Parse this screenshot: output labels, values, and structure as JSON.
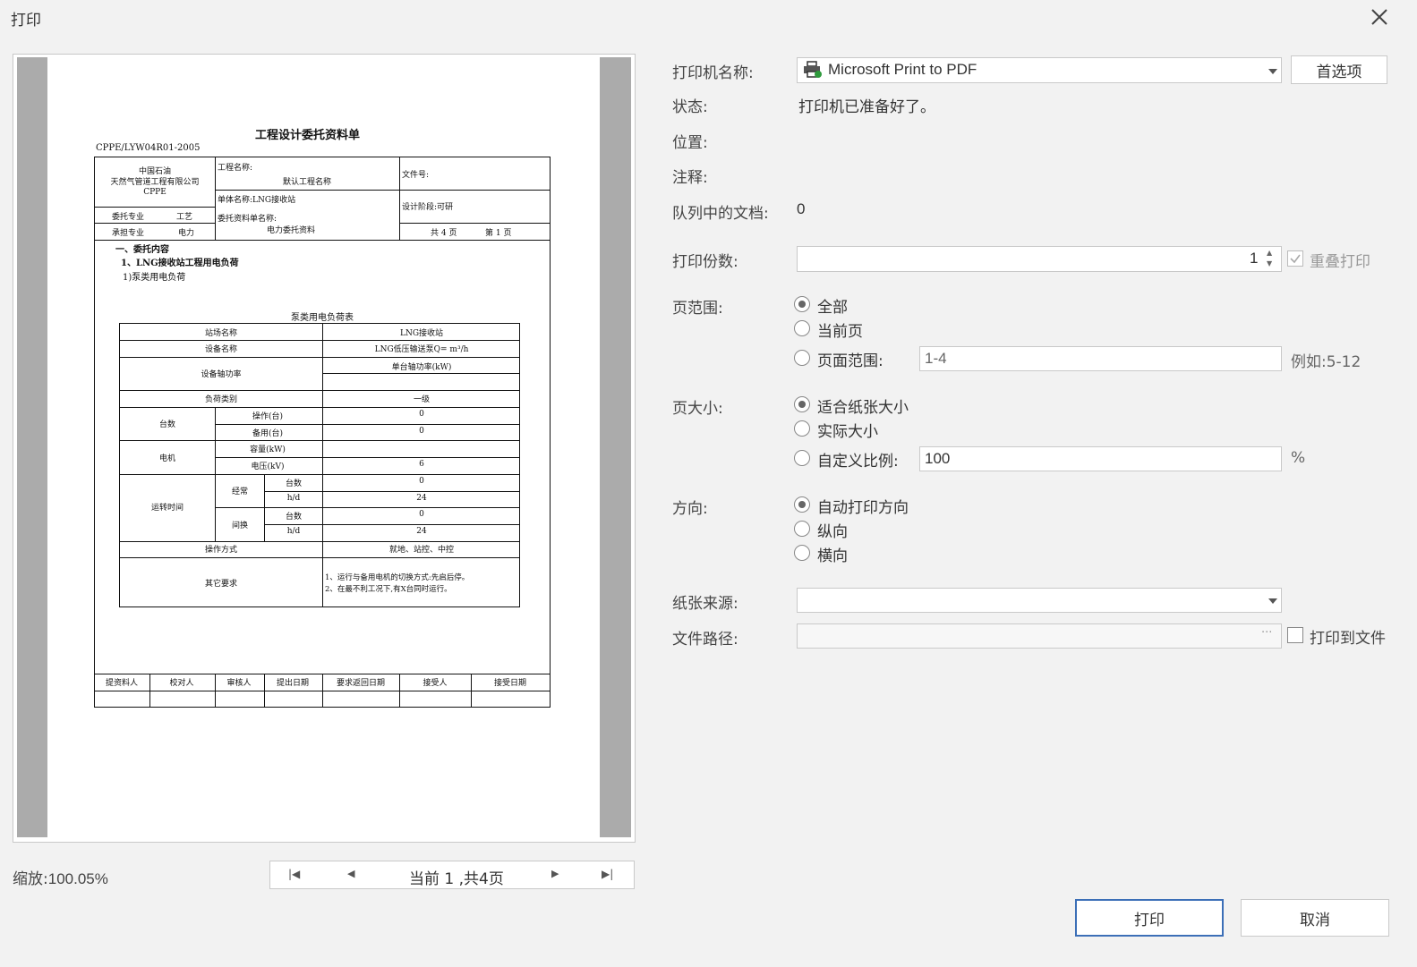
{
  "dialog": {
    "title": "打印"
  },
  "preview": {
    "zoom_label": "缩放:",
    "zoom_value": "100.05%",
    "nav": {
      "current_prefix": "当前",
      "current": "1",
      "sep": ",共",
      "total": "4",
      "suffix": "页"
    }
  },
  "document": {
    "title": "工程设计委托资料单",
    "code": "CPPE/LYW04R01-2005",
    "org1": "中国石油",
    "org2": "天然气管道工程有限公司",
    "org3": "CPPE",
    "project_name_label": "工程名称:",
    "project_name": "默认工程名称",
    "file_no_label": "文件号:",
    "unit_label": "单体名称:LNG接收站",
    "stage_label": "设计阶段:可研",
    "delegate_major_label": "委托专业",
    "delegate_major": "工艺",
    "receive_major_label": "承担专业",
    "receive_major": "电力",
    "form_name_label": "委托资料单名称:",
    "form_name": "电力委托资料",
    "pages_total": "共 4 页",
    "pages_current": "第 1 页",
    "sec1": "一、委托内容",
    "sec2": "1、LNG接收站工程用电负荷",
    "sec3": "1)泵类用电负荷",
    "table_title": "泵类用电负荷表",
    "rows": {
      "station_label": "站场名称",
      "station": "LNG接收站",
      "equip_label": "设备名称",
      "equip": "LNG低压输送泵Q= m³/h",
      "shaft_label": "设备轴功率",
      "shaft": "单台轴功率(kW)",
      "load_label": "负荷类别",
      "load": "一级",
      "count_label": "台数",
      "op_label": "操作(台)",
      "op": "0",
      "spare_label": "备用(台)",
      "spare": "0",
      "motor_label": "电机",
      "cap_label": "容量(kW)",
      "cap": "",
      "volt_label": "电压(kV)",
      "volt": "6",
      "runtime_label": "运转时间",
      "cont_label": "经常",
      "inter_label": "间换",
      "c_count_label": "台数",
      "c_count": "0",
      "c_hd_label": "h/d",
      "c_hd": "24",
      "i_count_label": "台数",
      "i_count": "0",
      "i_hd_label": "h/d",
      "i_hd": "24",
      "opmode_label": "操作方式",
      "opmode": "就地、站控、中控",
      "other_label": "其它要求",
      "other1": "1、运行与备用电机的切换方式:先启后停。",
      "other2": "2、在最不利工况下,有X台同时运行。"
    },
    "footer": [
      "提资料人",
      "校对人",
      "审核人",
      "提出日期",
      "要求返回日期",
      "接受人",
      "接受日期"
    ]
  },
  "printer": {
    "name_label": "打印机名称:",
    "name": "Microsoft Print to PDF",
    "prefs_button": "首选项",
    "status_label": "状态:",
    "status": "打印机已准备好了。",
    "location_label": "位置:",
    "comment_label": "注释:",
    "queue_label": "队列中的文档:",
    "queue": "0"
  },
  "copies": {
    "label": "打印份数:",
    "value": "1",
    "collate_label": "重叠打印"
  },
  "page_range": {
    "label": "页范围:",
    "all": "全部",
    "current": "当前页",
    "range": "页面范围:",
    "range_value": "1-4",
    "example": "例如:5-12"
  },
  "page_size": {
    "label": "页大小:",
    "fit": "适合纸张大小",
    "actual": "实际大小",
    "custom": "自定义比例:",
    "custom_value": "100",
    "percent": "%"
  },
  "orientation": {
    "label": "方向:",
    "auto": "自动打印方向",
    "portrait": "纵向",
    "landscape": "横向"
  },
  "paper_source": {
    "label": "纸张来源:"
  },
  "file_path": {
    "label": "文件路径:",
    "browse": "···",
    "print_to_file": "打印到文件"
  },
  "actions": {
    "print": "打印",
    "cancel": "取消"
  }
}
